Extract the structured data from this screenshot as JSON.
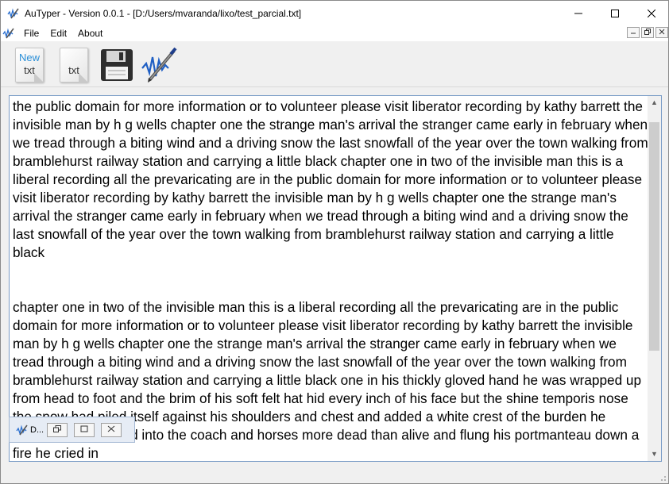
{
  "window": {
    "title": "AuTyper - Version 0.0.1 - [D:/Users/mvaranda/lixo/test_parcial.txt]",
    "minimize_icon": "minimize-icon",
    "maximize_icon": "maximize-icon",
    "close_icon": "close-icon"
  },
  "menubar": {
    "items": [
      {
        "label": "File"
      },
      {
        "label": "Edit"
      },
      {
        "label": "About"
      }
    ]
  },
  "toolbar": {
    "new_top": "New",
    "new_bottom": "txt",
    "open_bottom": "txt",
    "save_icon": "floppy-disk-icon",
    "transcribe_icon": "pen-waveform-icon"
  },
  "editor": {
    "text": "the public domain for more information or to volunteer please visit liberator recording by kathy barrett the invisible man by h g wells chapter one the strange man's arrival the stranger came early in february when we tread through a biting wind and a driving snow the last snowfall of the year over the town walking from bramblehurst railway station and carrying a little black chapter one in two of the invisible man this is a liberal recording all the prevaricating are in the public domain for more information or to volunteer please visit liberator recording by kathy barrett the invisible man by h g wells chapter one the strange man's arrival the stranger came early in february when we tread through a biting wind and a driving snow the last snowfall of the year over the town walking from bramblehurst railway station and carrying a little black\n\n\nchapter one in two of the invisible man this is a liberal recording all the prevaricating are in the public domain for more information or to volunteer please visit liberator recording by kathy barrett the invisible man by h g wells chapter one the strange man's arrival the stranger came early in february when we tread through a biting wind and a driving snow the last snowfall of the year over the town walking from bramblehurst railway station and carrying a little black one in his thickly gloved hand he was wrapped up from head to foot and the brim of his soft felt hat hid every inch of his face but the shine temporis nose the snow had piled itself against his shoulders and chest and added a white crest of the burden he carried he staggered into the coach and horses more dead than alive and flung his portmanteau down a fire he cried in"
  },
  "minimized_window": {
    "title": "D..."
  },
  "colors": {
    "titlebar_bg": "#ffffff",
    "editor_border": "#7a9cc6",
    "accent_blue": "#2a8fd8"
  }
}
